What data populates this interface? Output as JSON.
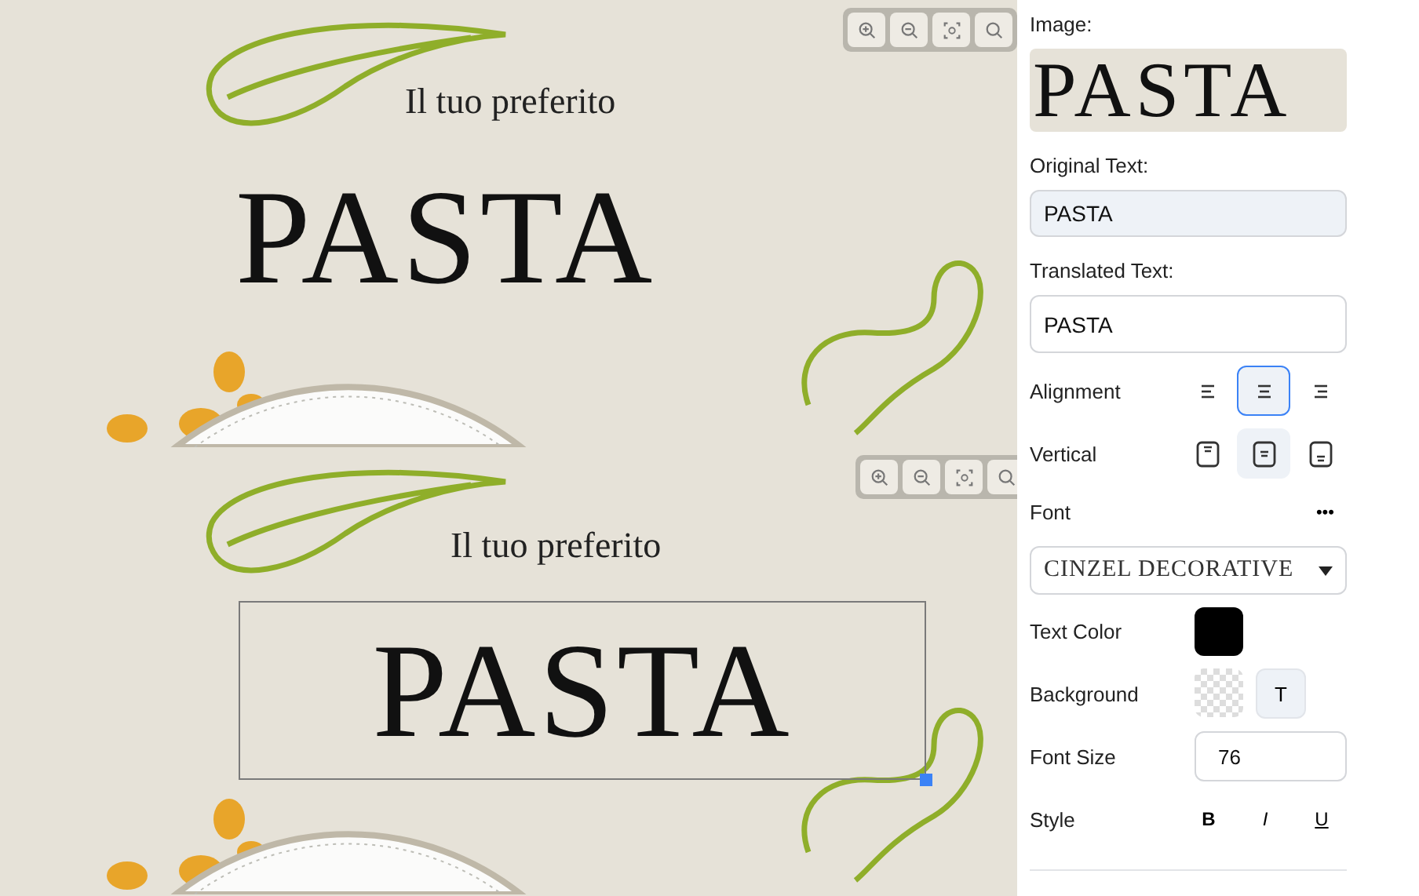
{
  "canvases": [
    {
      "tagline": "Il tuo preferito",
      "headline": "PASTA",
      "headline_selected": false
    },
    {
      "tagline": "Il tuo preferito",
      "headline": "PASTA",
      "headline_selected": true
    }
  ],
  "panel": {
    "image_label": "Image:",
    "image_preview": "PASTA",
    "original_label": "Original Text:",
    "original_value": "PASTA",
    "original_readonly": true,
    "translated_label": "Translated Text:",
    "translated_value": "PASTA",
    "alignment_label": "Alignment",
    "alignment": [
      {
        "kind": "left",
        "selected": false
      },
      {
        "kind": "center",
        "selected": true
      },
      {
        "kind": "right",
        "selected": false
      }
    ],
    "vertical_label": "Vertical",
    "vertical": [
      {
        "kind": "top",
        "selected": false
      },
      {
        "kind": "middle",
        "selected": true
      },
      {
        "kind": "bottom",
        "selected": false
      }
    ],
    "font_label": "Font",
    "font_more": "•••",
    "font_value": "CINZEL DECORATIVE",
    "text_color_label": "Text Color",
    "text_color_swatch": {
      "color": "#000000"
    },
    "background_label": "Background",
    "background_transparent": true,
    "background_button": "T",
    "font_size_label": "Font Size",
    "font_size": "76",
    "style_label": "Style",
    "styles": [
      {
        "label": "B",
        "selected": false
      },
      {
        "label": "I",
        "selected": false
      },
      {
        "label": "U",
        "selected": false
      }
    ]
  }
}
